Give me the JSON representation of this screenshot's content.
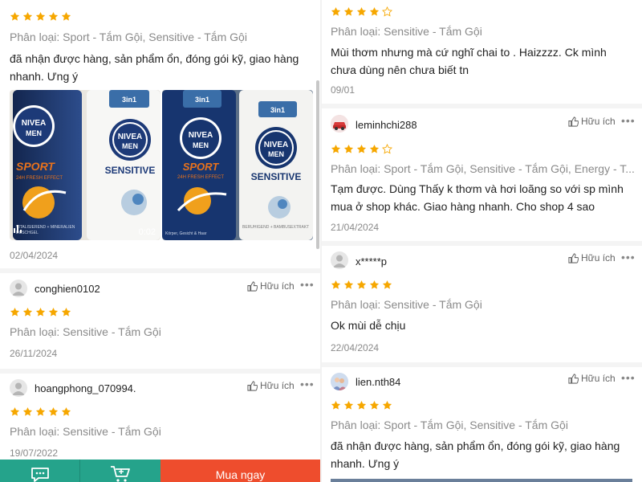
{
  "left": {
    "review1": {
      "rating": 5,
      "variant": "Phân loại: Sport - Tắm Gội, Sensitive - Tắm Gội",
      "text": "đã nhận được hàng, sản phẩm ổn, đóng gói kỹ, giao hàng nhanh. Ưng ý",
      "video_duration": "0:02",
      "date": "02/04/2024",
      "media": [
        {
          "brand": "NIVEA",
          "sub": "MEN",
          "badge": "3in1",
          "line1": "SPORT",
          "line2": "24H FRESH EFFECT",
          "line3": "SENSITIVE",
          "line4": "VITALISIEREND + MINERALIEN",
          "line5": "DUSCHGEL"
        },
        {
          "brand": "NIVEA",
          "sub": "MEN",
          "badge": "3in1",
          "line1": "SPORT",
          "line2": "24H FRESH EFFECT",
          "line3": "SENSITIVE",
          "line4": "BERUHIGEND + BAMBUSEXTRAKT",
          "line5": "Körper, Gesicht & Haar"
        }
      ]
    },
    "review2": {
      "username": "conghien0102",
      "helpful_label": "Hữu ích",
      "rating": 5,
      "variant": "Phân loại: Sensitive - Tắm Gội",
      "date": "26/11/2024"
    },
    "review3": {
      "username": "hoangphong_070994.",
      "helpful_label": "Hữu ích",
      "rating": 5,
      "variant": "Phân loại: Sensitive - Tắm Gội",
      "date": "19/07/2022"
    },
    "bottom_bar": {
      "buy_label": "Mua ngay",
      "chat_icon": "chat-icon",
      "cart_icon": "cart-icon"
    }
  },
  "right": {
    "review1": {
      "rating": 4,
      "variant": "Phân loại: Sensitive - Tắm Gội",
      "text": "Mùi thơm nhưng mà cứ nghĩ chai to . Haizzzz. Ck mình chưa dùng nên chưa biết tn",
      "date": "09/01"
    },
    "review2": {
      "username": "leminhchi288",
      "helpful_label": "Hữu ích",
      "rating": 4,
      "variant": "Phân loại: Sport - Tắm Gội, Sensitive - Tắm Gội, Energy - T...",
      "text": "Tạm được. Dùng Thấy k thơm và hơi loãng so với sp mình mua ở shop khác. Giao hàng nhanh. Cho shop 4 sao",
      "date": "21/04/2024"
    },
    "review3": {
      "username": "x*****p",
      "helpful_label": "Hữu ích",
      "rating": 5,
      "variant": "Phân loại: Sensitive - Tắm Gội",
      "text": "Ok mùi dễ chịu",
      "date": "22/04/2024"
    },
    "review4": {
      "username": "lien.nth84",
      "helpful_label": "Hữu ích",
      "rating": 5,
      "variant": "Phân loại: Sport - Tắm Gội, Sensitive - Tắm Gội",
      "text": "đã nhận được hàng, sản phẩm ổn, đóng gói kỹ, giao hàng nhanh. Ưng ý"
    }
  },
  "colors": {
    "star": "#f6a700",
    "star_empty": "#f6a700",
    "accent_green": "#25a38b",
    "buy_orange": "#ee4d2d",
    "nivea_blue": "#1d3a78",
    "sport_orange": "#e8721c"
  }
}
